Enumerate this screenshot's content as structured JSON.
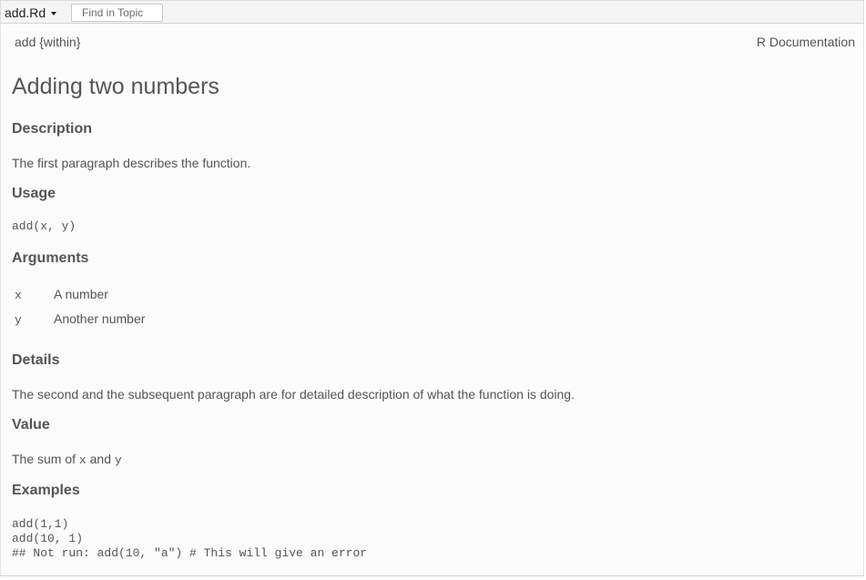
{
  "toolbar": {
    "topic_label": "add.Rd",
    "find_placeholder": "Find in Topic",
    "find_value": ""
  },
  "header": {
    "topic_package": "add {within}",
    "doc_label": "R Documentation"
  },
  "page": {
    "title": "Adding two numbers"
  },
  "sections": {
    "description": {
      "heading": "Description",
      "text": "The first paragraph describes the function."
    },
    "usage": {
      "heading": "Usage",
      "code": "add(x, y)"
    },
    "arguments": {
      "heading": "Arguments",
      "items": [
        {
          "name": "x",
          "desc": "A number"
        },
        {
          "name": "y",
          "desc": "Another number"
        }
      ]
    },
    "details": {
      "heading": "Details",
      "text": "The second and the subsequent paragraph are for detailed description of what the function is doing."
    },
    "value": {
      "heading": "Value",
      "text_prefix": "The sum of ",
      "code_x": "x",
      "text_and": " and ",
      "code_y": "y"
    },
    "examples": {
      "heading": "Examples",
      "lines": [
        "add(1,1)",
        "add(10, 1)",
        "## Not run: add(10, \"a\") # This will give an error"
      ]
    }
  },
  "colors": {
    "text": "#555555",
    "toolbar_bg": "#f5f5f5",
    "content_bg": "#fbfbfb"
  }
}
